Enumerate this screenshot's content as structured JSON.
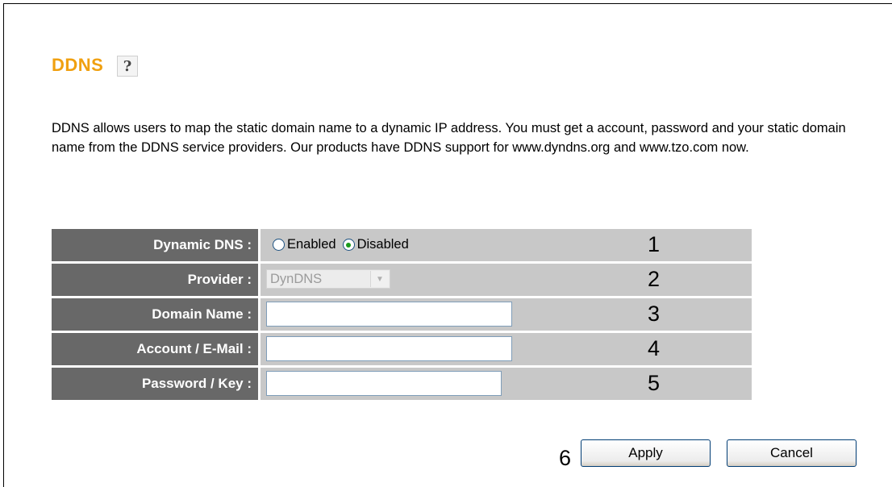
{
  "title": "DDNS",
  "help_icon_glyph": "?",
  "description": "DDNS allows users to map the static domain name to a dynamic IP address. You must get a account, password and your static domain name from the DDNS service providers. Our products have DDNS support for www.dyndns.org and www.tzo.com now.",
  "form": {
    "dynamic_dns": {
      "label": "Dynamic DNS :",
      "options": [
        "Enabled",
        "Disabled"
      ],
      "selected": "Disabled"
    },
    "provider": {
      "label": "Provider :",
      "value": "DynDNS",
      "disabled": true
    },
    "domain_name": {
      "label": "Domain Name :",
      "value": ""
    },
    "account": {
      "label": "Account / E-Mail :",
      "value": ""
    },
    "password": {
      "label": "Password / Key :",
      "value": ""
    }
  },
  "step_numbers": [
    "1",
    "2",
    "3",
    "4",
    "5",
    "6"
  ],
  "buttons": {
    "apply_label": "Apply",
    "cancel_label": "Cancel"
  },
  "colors": {
    "title": "#f0a010",
    "label_bg": "#686868",
    "value_bg": "#c8c8c8",
    "radio_selected": "#1b9a1b"
  }
}
